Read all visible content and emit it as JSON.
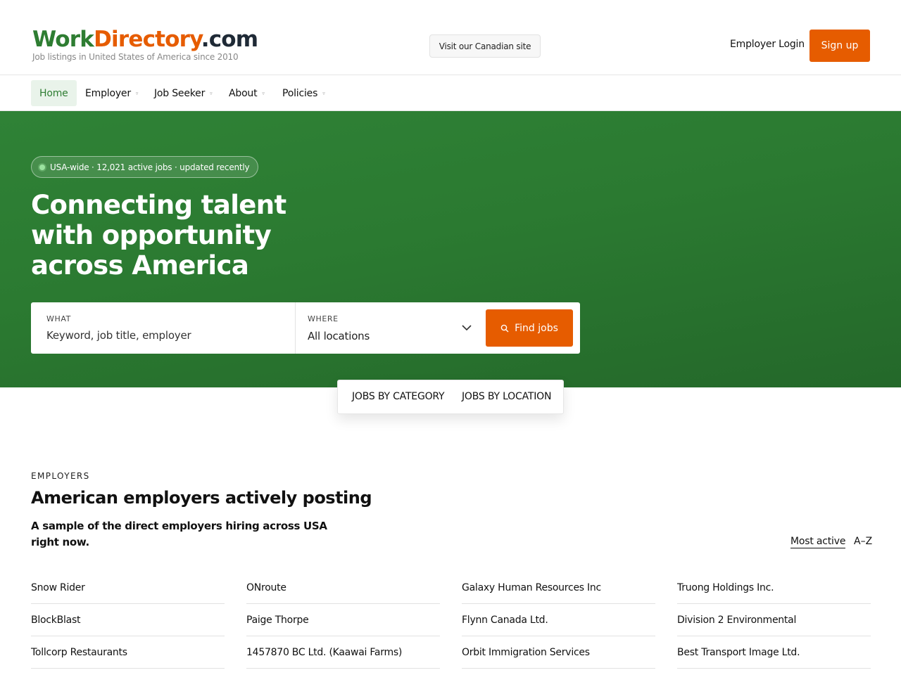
{
  "header": {
    "logo_work": "Work",
    "logo_directory": "Directory",
    "logo_com": ".com",
    "tagline": "Job listings in United States of America since 2010",
    "canada_button": "Visit our Canadian site",
    "employer_login": "Employer Login",
    "signup_button": "Sign up"
  },
  "nav": {
    "items": [
      {
        "label": "Home",
        "active": true
      },
      {
        "label": "Employer",
        "dropdown": true
      },
      {
        "label": "Job Seeker",
        "dropdown": true
      },
      {
        "label": "About",
        "dropdown": true
      },
      {
        "label": "Policies",
        "dropdown": true
      }
    ]
  },
  "hero": {
    "pill": "USA-wide · 12,021 active jobs · updated recently",
    "title": "Connecting talent with opportunity across America",
    "search": {
      "what_label": "WHAT",
      "what_placeholder": "Keyword, job title, employer",
      "where_label": "WHERE",
      "where_value": "All locations",
      "find_button": "Find jobs"
    }
  },
  "tabs": {
    "category": "JOBS BY CATEGORY",
    "location": "JOBS BY LOCATION"
  },
  "employers": {
    "eyebrow": "EMPLOYERS",
    "title": "American employers actively posting",
    "subtitle": "A sample of the direct employers hiring across USA right now.",
    "sort_active": "Most active",
    "sort_az": "A–Z",
    "columns": [
      [
        "Snow Rider",
        "BlockBlast",
        "Tollcorp Restaurants"
      ],
      [
        "ONroute",
        "Paige Thorpe",
        "1457870 BC Ltd. (Kaawai Farms)"
      ],
      [
        "Galaxy Human Resources Inc",
        "Flynn Canada Ltd.",
        "Orbit Immigration Services"
      ],
      [
        "Truong Holdings Inc.",
        "Division 2 Environmental",
        "Best Transport Image Ltd."
      ]
    ]
  },
  "colors": {
    "brand_green": "#2e7d32",
    "brand_orange": "#e65c00",
    "hero_green": "#2b7a31"
  },
  "icons": {
    "find": "search-icon",
    "where": "chevron-down-icon",
    "nav_dropdown": "caret-icon",
    "pill": "status-dot-icon"
  }
}
